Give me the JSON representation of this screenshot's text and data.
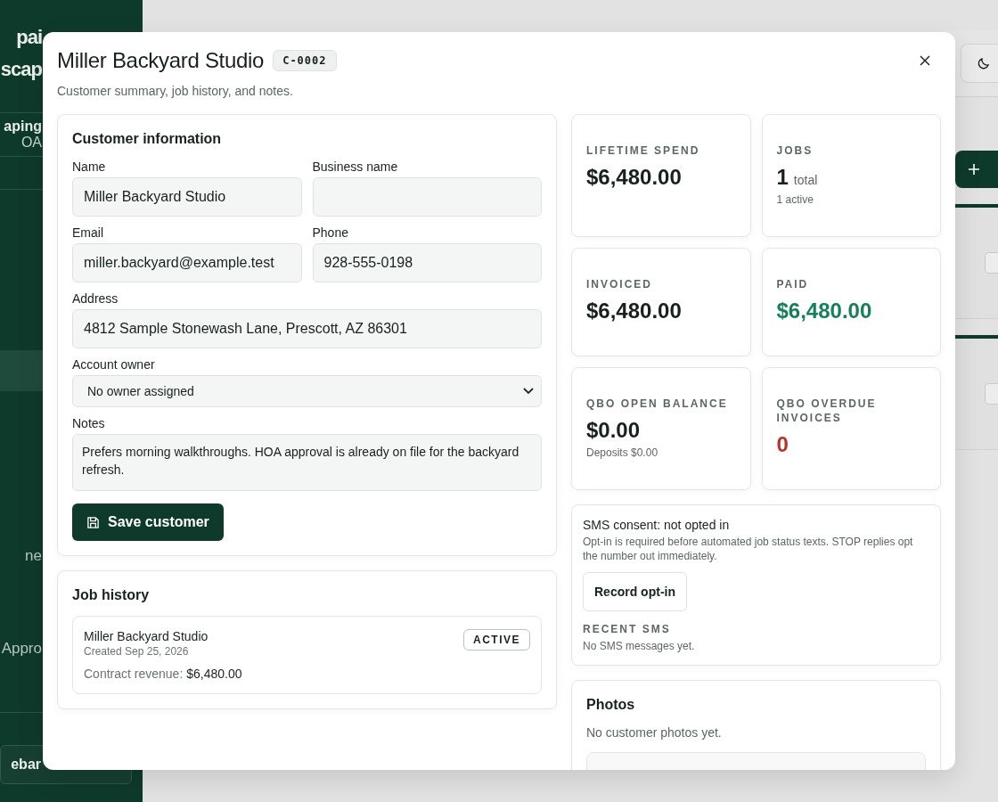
{
  "sidebar": {
    "brand_lines": [
      "pai",
      "scap"
    ],
    "workspace": {
      "name": "aping",
      "subtitle": "OA"
    },
    "items": [
      {
        "selected": true
      },
      {
        "label": "ne",
        "selected": false
      },
      {
        "label": "Appro",
        "selected": false
      }
    ],
    "footer_button": "ebar"
  },
  "modal": {
    "title": "Miller Backyard Studio",
    "code": "C-0002",
    "subtitle": "Customer summary, job history, and notes.",
    "customer_info": {
      "heading": "Customer information",
      "field_rows": [
        [
          {
            "label": "Name",
            "value": "Miller Backyard Studio",
            "kind": "input"
          },
          {
            "label": "Business name",
            "kind": "input"
          }
        ],
        [
          {
            "label": "Email",
            "value": "miller.backyard@example.test",
            "kind": "input"
          },
          {
            "label": "Phone",
            "value": "928-555-0198",
            "kind": "input"
          }
        ],
        [
          {
            "label": "Address",
            "value": "4812 Sample Stonewash Lane, Prescott, AZ 86301",
            "kind": "input"
          }
        ],
        [
          {
            "label": "Account owner",
            "value": "No owner assigned",
            "kind": "select"
          }
        ],
        [
          {
            "label": "Notes",
            "value": "Prefers morning walkthroughs. HOA approval is already on file for the backyard refresh.",
            "kind": "textarea"
          }
        ]
      ],
      "save_button": "Save customer"
    },
    "job_history": {
      "heading": "Job history",
      "jobs": [
        {
          "name": "Miller Backyard Studio",
          "created": "Created Sep 25, 2026",
          "revenue": "Contract revenue: **$6,480.00**",
          "status": "ACTIVE"
        }
      ]
    },
    "stats": [
      {
        "label": "LIFETIME SPEND",
        "value": "$6,480.00",
        "color": "#17211d"
      },
      {
        "label": "JOBS",
        "value": "1",
        "unit": "total",
        "note": "1 active",
        "color": "#17211d"
      },
      {
        "label": "INVOICED",
        "value": "$6,480.00",
        "color": "#17211d"
      },
      {
        "label": "PAID",
        "value": "$6,480.00",
        "color": "#17805a"
      },
      {
        "label": "QBO OPEN BALANCE",
        "value": "$0.00",
        "note": "Deposits $0.00",
        "color": "#17211d"
      },
      {
        "label": "QBO OVERDUE INVOICES",
        "value": "0",
        "color": "#b8322b"
      }
    ],
    "sms": {
      "title": "SMS consent: not opted in",
      "description": "Opt-in is required before automated job status texts. STOP replies opt the number out immediately.",
      "button": "Record opt-in",
      "recent_heading": "RECENT SMS",
      "empty": "No SMS messages yet."
    },
    "photos": {
      "heading": "Photos",
      "empty": "No customer photos yet."
    }
  }
}
